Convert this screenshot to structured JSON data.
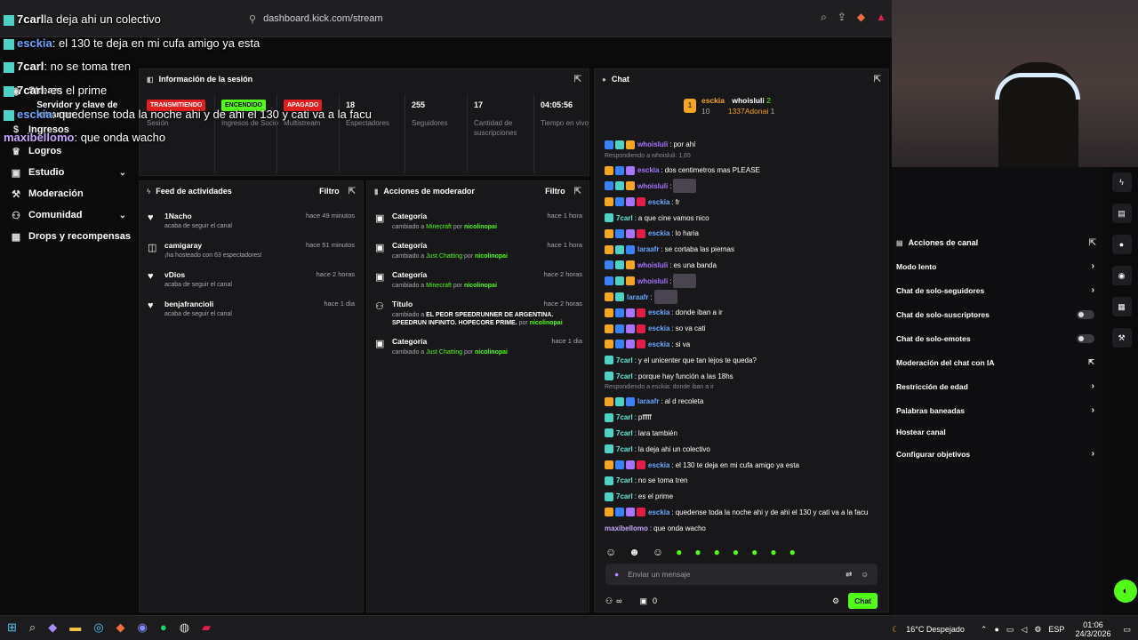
{
  "browser": {
    "url": "dashboard.kick.com/stream"
  },
  "overlay": [
    {
      "user": "7carl",
      "text": "la deja ahi un colectivo",
      "color": "#fff"
    },
    {
      "user": "esckia",
      "text": ": el 130 te deja en mi cufa amigo ya esta",
      "color": "#6aa7ff"
    },
    {
      "user": "7carl",
      "text": ": no se toma tren",
      "color": "#fff"
    },
    {
      "user": "7carl",
      "text": ": es el prime",
      "color": "#fff"
    },
    {
      "user": "esckia",
      "text": ": quedense toda la noche ahi y de ahi el 130 y cati va a la facu",
      "color": "#6aa7ff"
    },
    {
      "user": "maxibellomo",
      "text": ": que onda wacho",
      "color": "#c7a6ff"
    }
  ],
  "sidebar": {
    "items": [
      {
        "label": "Stream",
        "icon": "broadcast-icon"
      },
      {
        "label": "Servidor y clave de retransm",
        "icon": ""
      },
      {
        "label": "Ingresos",
        "icon": "money-icon"
      },
      {
        "label": "Logros",
        "icon": "trophy-icon"
      },
      {
        "label": "Estudio",
        "icon": "studio-icon",
        "chevron": true
      },
      {
        "label": "Moderación",
        "icon": "wrench-icon"
      },
      {
        "label": "Comunidad",
        "icon": "community-icon",
        "chevron": true
      },
      {
        "label": "Drops y recompensas",
        "icon": "gift-icon"
      }
    ]
  },
  "session": {
    "title": "Información de la sesión",
    "stats": [
      {
        "tag": "TRANSMITIENDO",
        "tagcolor": "#e11d1d",
        "label": "Sesión"
      },
      {
        "tag": "ENCENDIDO",
        "tagcolor": "#53fc18",
        "label": "Ingresos de Socio"
      },
      {
        "tag": "APAGADO",
        "tagcolor": "#e11d1d",
        "label": "Multistream"
      },
      {
        "value": "18",
        "label": "Espectadores"
      },
      {
        "value": "255",
        "label": "Seguidores"
      },
      {
        "value": "17",
        "label": "Cantidad de suscripciones"
      },
      {
        "value": "04:05:56",
        "label": "Tiempo en vivo"
      }
    ]
  },
  "feed": {
    "title": "Feed de actividades",
    "filter": "Filtro",
    "items": [
      {
        "name": "1Nacho",
        "sub": "acaba de seguir el canal",
        "time": "hace 49 minutos",
        "icon": "heart-icon"
      },
      {
        "name": "camigaray",
        "sub": "¡ha hosteado con 63 espectadores!",
        "time": "hace 51 minutos",
        "icon": "host-icon"
      },
      {
        "name": "vDios",
        "sub": "acaba de seguir el canal",
        "time": "hace 2 horas",
        "icon": "heart-icon"
      },
      {
        "name": "benjafrancioli",
        "sub": "acaba de seguir el canal",
        "time": "hace 1 dia",
        "icon": "heart-icon"
      }
    ]
  },
  "mod": {
    "title": "Acciones de moderador",
    "filter": "Filtro",
    "items": [
      {
        "name": "Categoría",
        "pre": "cambiado a ",
        "what": "Minecraft",
        "by": "nicolinopai",
        "time": "hace 1 hora"
      },
      {
        "name": "Categoría",
        "pre": "cambiado a ",
        "what": "Just Chatting",
        "by": "nicolinopai",
        "time": "hace 1 hora"
      },
      {
        "name": "Categoría",
        "pre": "cambiado a ",
        "what": "Minecraft",
        "by": "nicolinopai",
        "time": "hace 2 horas"
      },
      {
        "name": "Título",
        "pre": "cambiado a ",
        "what": "EL PEOR SPEEDRUNNER DE ARGENTINA. SPEEDRUN INFINITO. HOPECORE PRIME.",
        "by": "nicolinopai",
        "time": "hace 2 horas"
      },
      {
        "name": "Categoría",
        "pre": "cambiado a ",
        "what": "Just Chatting",
        "by": "nicolinopai",
        "time": "hace 1 dia"
      }
    ]
  },
  "chat": {
    "title": "Chat",
    "pinned": {
      "u1": "esckia",
      "n1": "10",
      "u2": "whoisluli",
      "n2": "2",
      "u3": "1337Adonai",
      "n3": "1"
    },
    "messages": [
      {
        "u": "whoisluli",
        "c": "#a774ff",
        "t": "por ahí",
        "b": [
          "#3b82f6",
          "#4fd1c5",
          "#f5a524"
        ]
      },
      {
        "reply": "Respondiendo a whoisluli: 1,65"
      },
      {
        "u": "esckia",
        "c": "#a774ff",
        "t": "dos centimetros mas PLEASE",
        "b": [
          "#f5a524",
          "#3b82f6",
          "#a774ff"
        ]
      },
      {
        "u": "whoisluli",
        "c": "#a774ff",
        "t": "",
        "b": [
          "#3b82f6",
          "#4fd1c5",
          "#f5a524"
        ]
      },
      {
        "u": "esckia",
        "c": "#6aa7ff",
        "t": "fr",
        "b": [
          "#f5a524",
          "#3b82f6",
          "#a774ff",
          "#e11d48"
        ]
      },
      {
        "u": "7carl",
        "c": "#5eead4",
        "t": "a que cine vamos nico",
        "b": [
          "#4fd1c5"
        ]
      },
      {
        "u": "esckia",
        "c": "#6aa7ff",
        "t": "lo haria",
        "b": [
          "#f5a524",
          "#3b82f6",
          "#a774ff",
          "#e11d48"
        ]
      },
      {
        "u": "laraafr",
        "c": "#6aa7ff",
        "t": "se cortaba las piernas",
        "b": [
          "#f5a524",
          "#4fd1c5",
          "#3b82f6"
        ]
      },
      {
        "u": "whoisluli",
        "c": "#a774ff",
        "t": "es una banda",
        "b": [
          "#3b82f6",
          "#4fd1c5",
          "#f5a524"
        ]
      },
      {
        "u": "whoisluli",
        "c": "#a774ff",
        "t": "",
        "b": [
          "#3b82f6",
          "#4fd1c5",
          "#f5a524"
        ]
      },
      {
        "u": "laraafr",
        "c": "#6aa7ff",
        "t": "",
        "b": [
          "#f5a524",
          "#4fd1c5"
        ]
      },
      {
        "u": "esckia",
        "c": "#6aa7ff",
        "t": "donde iban a ir",
        "b": [
          "#f5a524",
          "#3b82f6",
          "#a774ff",
          "#e11d48"
        ]
      },
      {
        "u": "esckia",
        "c": "#6aa7ff",
        "t": "so va cati",
        "b": [
          "#f5a524",
          "#3b82f6",
          "#a774ff",
          "#e11d48"
        ]
      },
      {
        "u": "esckia",
        "c": "#6aa7ff",
        "t": "si va",
        "b": [
          "#f5a524",
          "#3b82f6",
          "#a774ff",
          "#e11d48"
        ]
      },
      {
        "u": "7carl",
        "c": "#5eead4",
        "t": "y el unicenter que tan lejos te queda?",
        "b": [
          "#4fd1c5"
        ]
      },
      {
        "u": "7carl",
        "c": "#5eead4",
        "t": "porque hay función a las 18hs",
        "b": [
          "#4fd1c5"
        ]
      },
      {
        "reply": "Respondiendo a esckia: donde iban a ir"
      },
      {
        "u": "laraafr",
        "c": "#6aa7ff",
        "t": "al d recoleta",
        "b": [
          "#f5a524",
          "#4fd1c5",
          "#3b82f6"
        ]
      },
      {
        "u": "7carl",
        "c": "#5eead4",
        "t": "pfffff",
        "b": [
          "#4fd1c5"
        ]
      },
      {
        "u": "7carl",
        "c": "#5eead4",
        "t": "lara también",
        "b": [
          "#4fd1c5"
        ]
      },
      {
        "u": "7carl",
        "c": "#5eead4",
        "t": "la deja ahi un colectivo",
        "b": [
          "#4fd1c5"
        ]
      },
      {
        "u": "esckia",
        "c": "#6aa7ff",
        "t": "el 130 te deja en mi cufa amigo ya esta",
        "b": [
          "#f5a524",
          "#3b82f6",
          "#a774ff",
          "#e11d48"
        ]
      },
      {
        "u": "7carl",
        "c": "#5eead4",
        "t": "no se toma tren",
        "b": [
          "#4fd1c5"
        ]
      },
      {
        "u": "7carl",
        "c": "#5eead4",
        "t": "es el prime",
        "b": [
          "#4fd1c5"
        ]
      },
      {
        "u": "esckia",
        "c": "#6aa7ff",
        "t": "quedense toda la noche ahi y de ahi el 130 y cati va a la facu",
        "b": [
          "#f5a524",
          "#3b82f6",
          "#a774ff",
          "#e11d48"
        ]
      },
      {
        "u": "maxibellomo",
        "c": "#c7a6ff",
        "t": "que onda wacho",
        "b": []
      }
    ],
    "input_placeholder": "Enviar un mensaje",
    "footer_count": "0",
    "send": "Chat"
  },
  "acciones": {
    "title": "Acciones de canal",
    "items": [
      {
        "label": "Modo lento",
        "type": "arrow"
      },
      {
        "label": "Chat de solo-seguidores",
        "type": "arrow"
      },
      {
        "label": "Chat de solo-suscriptores",
        "type": "toggle"
      },
      {
        "label": "Chat de solo-emotes",
        "type": "toggle"
      },
      {
        "label": "Moderación del chat con IA",
        "type": "ext"
      },
      {
        "label": "Restricción de edad",
        "type": "arrow"
      },
      {
        "label": "Palabras baneadas",
        "type": "arrow"
      },
      {
        "label": "Hostear canal",
        "type": "none"
      },
      {
        "label": "Configurar objetivos",
        "type": "arrow"
      }
    ]
  },
  "taskbar": {
    "weather": "16°C Despejado",
    "lang": "ESP",
    "time": "01:06",
    "date": "24/3/2026"
  },
  "colors": {
    "accent": "#53fc18",
    "bg": "#0b0b0c",
    "panel": "#18181b"
  }
}
